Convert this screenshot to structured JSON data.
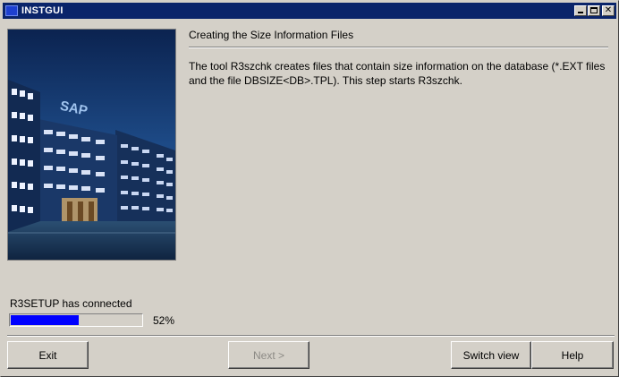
{
  "window": {
    "title": "INSTGUI",
    "controls": {
      "minimize": "minimize-icon",
      "maximize": "maximize-icon",
      "close": "close-icon"
    }
  },
  "image": {
    "description_icon": "office-building-photo",
    "sign_text": "SAP"
  },
  "content": {
    "heading": "Creating the Size Information Files",
    "body": "The tool R3szchk creates files that contain size information on the database (*.EXT files and the file DBSIZE<DB>.TPL). This step starts R3szchk."
  },
  "status": {
    "text": "R3SETUP has connected",
    "progress_fraction": 0.52,
    "percent_label": "52%"
  },
  "buttons": {
    "exit": "Exit",
    "next": "Next >",
    "next_enabled": false,
    "switch_view": "Switch view",
    "help": "Help"
  },
  "colors": {
    "titlebar": "#0a246a",
    "progress": "#0000ff",
    "face": "#d4d0c8"
  }
}
